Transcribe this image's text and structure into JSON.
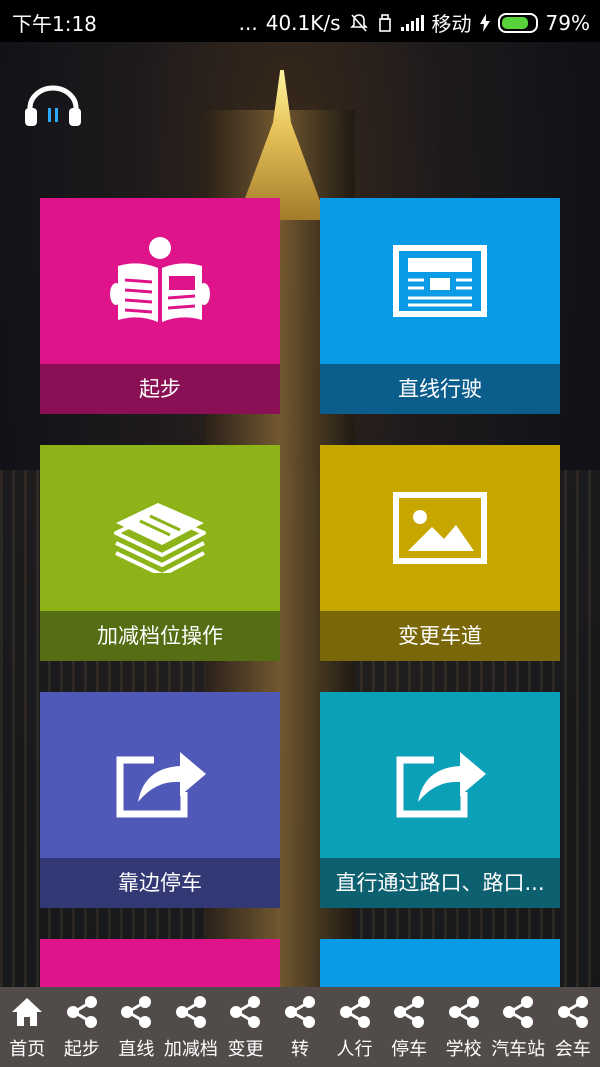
{
  "status_bar": {
    "time": "下午1:18",
    "dots": "...",
    "speed": "40.1K/s",
    "carrier": "移动",
    "battery": "79%",
    "battery_color": "#57d23a"
  },
  "audio_button": {
    "icon": "headphones-icon"
  },
  "tiles": [
    {
      "label": "起步",
      "icon": "newspaper-reader-icon",
      "color": "#e0148a"
    },
    {
      "label": "直线行驶",
      "icon": "news-icon",
      "color": "#0a9ae6"
    },
    {
      "label": "加减档位操作",
      "icon": "news-stack-icon",
      "color": "#8cb317"
    },
    {
      "label": "变更车道",
      "icon": "picture-icon",
      "color": "#c8a600"
    },
    {
      "label": "靠边停车",
      "icon": "share-arrow-icon",
      "color": "#5058b8"
    },
    {
      "label": "直行通过路口、路口...",
      "icon": "share-arrow-icon",
      "color": "#0aa0b8"
    }
  ],
  "bottom_nav": [
    {
      "label": "首页",
      "icon": "home-icon"
    },
    {
      "label": "起步",
      "icon": "share-icon"
    },
    {
      "label": "直线",
      "icon": "share-icon"
    },
    {
      "label": "加减档",
      "icon": "share-icon"
    },
    {
      "label": "变更",
      "icon": "share-icon"
    },
    {
      "label": "转",
      "icon": "share-icon"
    },
    {
      "label": "人行",
      "icon": "share-icon"
    },
    {
      "label": "停车",
      "icon": "share-icon"
    },
    {
      "label": "学校",
      "icon": "share-icon"
    },
    {
      "label": "汽车站",
      "icon": "share-icon"
    },
    {
      "label": "会车",
      "icon": "share-icon"
    }
  ]
}
